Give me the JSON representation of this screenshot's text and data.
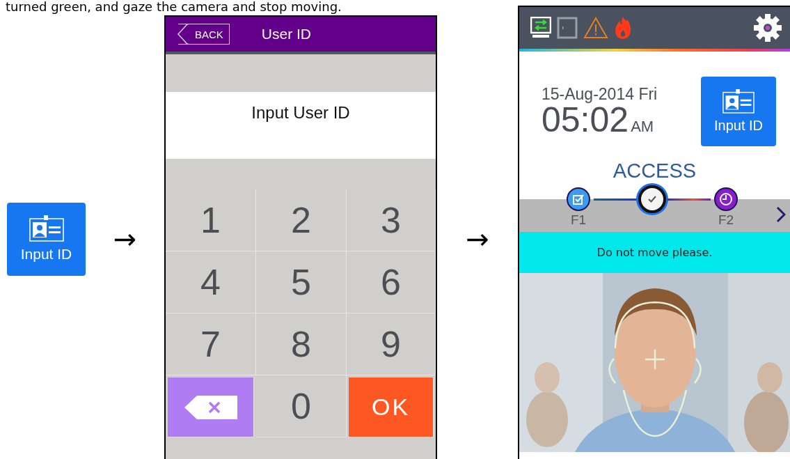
{
  "caption": "turned green, and gaze the camera and stop moving.",
  "input_id_button": {
    "label": "Input ID"
  },
  "flow_arrows": [
    "→",
    "→"
  ],
  "user_id_screen": {
    "back": "BACK",
    "title": "User ID",
    "prompt": "Input User ID",
    "keys": [
      {
        "kind": "digit",
        "label": "1"
      },
      {
        "kind": "digit",
        "label": "2"
      },
      {
        "kind": "digit",
        "label": "3"
      },
      {
        "kind": "digit",
        "label": "4"
      },
      {
        "kind": "digit",
        "label": "5"
      },
      {
        "kind": "digit",
        "label": "6"
      },
      {
        "kind": "digit",
        "label": "7"
      },
      {
        "kind": "digit",
        "label": "8"
      },
      {
        "kind": "digit",
        "label": "9"
      },
      {
        "kind": "delete"
      },
      {
        "kind": "digit",
        "label": "0"
      },
      {
        "kind": "ok",
        "label": "OK"
      }
    ]
  },
  "access_screen": {
    "date": "15-Aug-2014 Fri",
    "time": "05:02",
    "meridiem": "AM",
    "input_button": "Input ID",
    "mode": "ACCESS",
    "steps": [
      {
        "kind": "card",
        "label": "F1",
        "selected": false
      },
      {
        "kind": "check",
        "selected": true
      },
      {
        "kind": "clock",
        "label": "F2",
        "selected": false
      }
    ],
    "message": "Do not move please."
  }
}
